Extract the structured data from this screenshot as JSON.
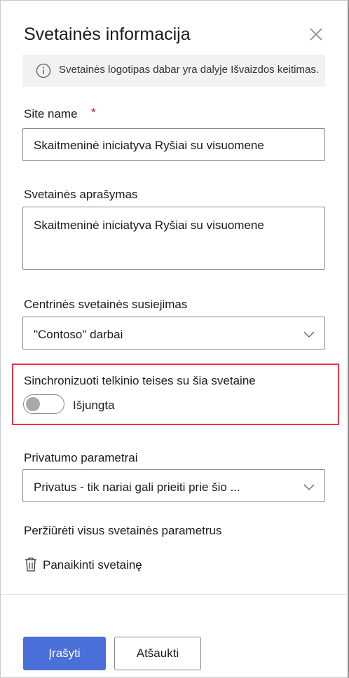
{
  "panel": {
    "title": "Svetainės informacija",
    "info_message": "Svetainės logotipas dabar yra dalyje Išvaizdos keitimas."
  },
  "site_name": {
    "label": "Site name",
    "required_mark": "*",
    "value": "Skaitmeninė iniciatyva Ryšiai su visuomene"
  },
  "site_description": {
    "label": "Svetainės aprašymas",
    "value": "Skaitmeninė iniciatyva Ryšiai su visuomene"
  },
  "hub_association": {
    "label": "Centrinės svetainės susiejimas",
    "selected": "\"Contoso\" darbai"
  },
  "sync_permissions": {
    "label": "Sinchronizuoti telkinio teises su šia svetaine",
    "toggle_state": "Išjungta",
    "highlight_color": "#e03c46"
  },
  "privacy": {
    "label": "Privatumo parametrai",
    "selected": "Privatus - tik nariai gali prieiti prie šio ..."
  },
  "view_all_link": "Peržiūrėti visus svetainės parametrus",
  "delete_site": "Panaikinti svetainę",
  "footer": {
    "save": "Įrašyti",
    "cancel": "Atšaukti",
    "primary_color": "#4a6fd8"
  }
}
